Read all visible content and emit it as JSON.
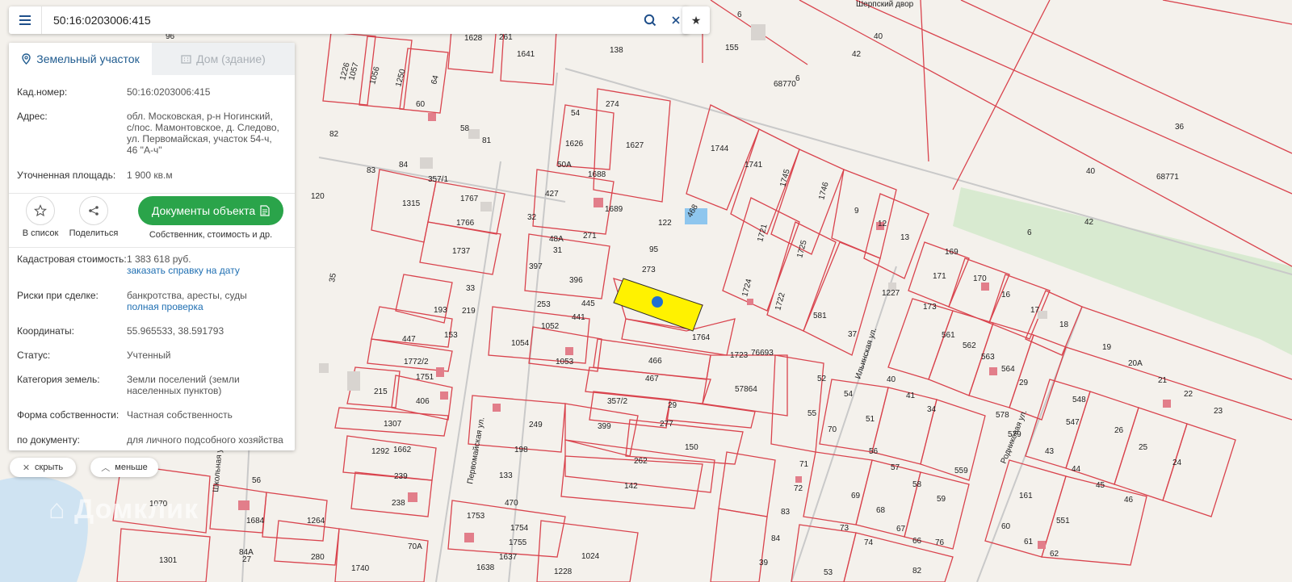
{
  "search": {
    "value": "50:16:0203006:415"
  },
  "tabs": [
    {
      "label": "Земельный участок",
      "active": true
    },
    {
      "label": "Дом (здание)",
      "active": false
    }
  ],
  "info": [
    {
      "label": "Кад.номер:",
      "value": "50:16:0203006:415",
      "is_link": true
    },
    {
      "label": "Адрес:",
      "value": "обл. Московская, р-н Ногинский, с/пос. Мамонтовское, д. Следово, ул. Первомайская, участок 54-ч, 46 \"А-ч\""
    },
    {
      "label": "Уточненная площадь:",
      "value": "1 900 кв.м"
    }
  ],
  "actions": {
    "favorite_label": "В список",
    "share_label": "Поделиться",
    "docs_button": "Документы объекта",
    "docs_sub": "Собственник, стоимость и др."
  },
  "details": [
    {
      "label": "Кадастровая стоимость:",
      "value": "1 383 618 руб.",
      "link": "заказать справку на дату"
    },
    {
      "label": "Риски при сделке:",
      "value": "банкротства, аресты, суды",
      "link": "полная проверка"
    },
    {
      "label": "Координаты:",
      "value": "55.965533, 38.591793"
    },
    {
      "label": "Статус:",
      "value": "Учтенный"
    },
    {
      "label": "Категория земель:",
      "value": "Земли поселений (земли населенных пунктов)"
    },
    {
      "label": "Форма собственности:",
      "value": "Частная собственность"
    },
    {
      "label": "по документу:",
      "value": "для личного подсобного хозяйства"
    }
  ],
  "buttons": {
    "hide": "скрыть",
    "less": "меньше"
  },
  "watermark": "Домклик",
  "colors": {
    "parcel_line": "#d9434d",
    "highlight": "#fff200",
    "marker": "#1f6fd1",
    "docs_green": "#2aa44a",
    "water": "#cfe3f2",
    "park": "#d8ead0"
  },
  "map": {
    "place_label": "Шерпский двор",
    "streets": [
      "Первомайская ул.",
      "Ильинская ул.",
      "Родниковая ул.",
      "Школьная ул."
    ],
    "parcels": [
      "6",
      "155",
      "6",
      "42",
      "40",
      "68770",
      "36",
      "40",
      "68771",
      "42",
      "6",
      "274",
      "1627",
      "1744",
      "1741",
      "1745",
      "1746",
      "1688",
      "1689",
      "122",
      "468",
      "95",
      "273",
      "1721",
      "1725",
      "1724",
      "1722",
      "581",
      "37",
      "1764",
      "1723",
      "76693",
      "466",
      "467",
      "57864",
      "357/2",
      "29",
      "277",
      "399",
      "150",
      "262",
      "142",
      "1024",
      "54",
      "1626",
      "50А",
      "427",
      "32",
      "271",
      "48А",
      "31",
      "397",
      "396",
      "253",
      "445",
      "441",
      "1052",
      "1054",
      "1053",
      "1641",
      "138",
      "1628",
      "261",
      "1315",
      "1767",
      "1766",
      "1737",
      "193",
      "153",
      "447",
      "1772/2",
      "1751",
      "215",
      "406",
      "1307",
      "1292",
      "1662",
      "239",
      "238",
      "1070",
      "1684",
      "1264",
      "1301",
      "280",
      "1740",
      "1638",
      "1637",
      "1755",
      "1754",
      "1753",
      "470",
      "133",
      "198",
      "249",
      "9",
      "12",
      "13",
      "169",
      "171",
      "170",
      "16",
      "17",
      "18",
      "173",
      "561",
      "562",
      "563",
      "564",
      "29",
      "19",
      "20А",
      "21",
      "22",
      "23",
      "51",
      "56",
      "57",
      "58",
      "59",
      "559",
      "578",
      "579",
      "43",
      "44",
      "45",
      "46",
      "548",
      "547",
      "26",
      "25",
      "24",
      "551",
      "161",
      "60",
      "61",
      "62",
      "69",
      "68",
      "73",
      "74",
      "67",
      "66",
      "76",
      "82",
      "53",
      "52",
      "54",
      "55",
      "70",
      "71",
      "72",
      "83",
      "84",
      "39",
      "40",
      "41",
      "34",
      "1227",
      "1057",
      "1056",
      "1250",
      "64",
      "60",
      "58",
      "81",
      "82",
      "83",
      "84",
      "357/1",
      "120",
      "35",
      "33",
      "219",
      "96",
      "56",
      "27",
      "70А",
      "84А",
      "1228",
      "1226"
    ]
  }
}
